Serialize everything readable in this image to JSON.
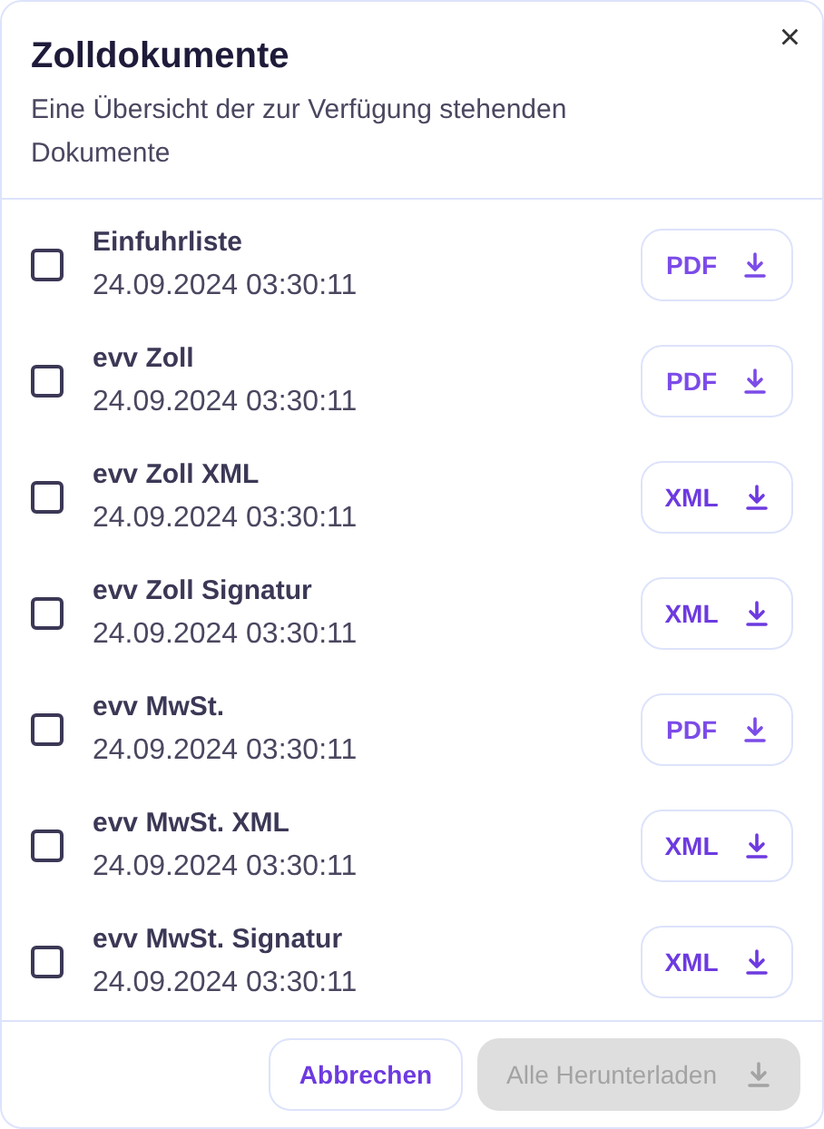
{
  "dialog": {
    "title": "Zolldokumente",
    "description": "Eine Übersicht der zur Verfügung stehenden Dokumente",
    "close": "×"
  },
  "documents": [
    {
      "name": "Einfuhrliste",
      "date": "24.09.2024 03:30:11",
      "format": "PDF",
      "checked": false
    },
    {
      "name": "evv Zoll",
      "date": "24.09.2024 03:30:11",
      "format": "PDF",
      "checked": false
    },
    {
      "name": "evv Zoll XML",
      "date": "24.09.2024 03:30:11",
      "format": "XML",
      "checked": false
    },
    {
      "name": "evv Zoll Signatur",
      "date": "24.09.2024 03:30:11",
      "format": "XML",
      "checked": false
    },
    {
      "name": "evv MwSt.",
      "date": "24.09.2024 03:30:11",
      "format": "PDF",
      "checked": false
    },
    {
      "name": "evv MwSt. XML",
      "date": "24.09.2024 03:30:11",
      "format": "XML",
      "checked": false
    },
    {
      "name": "evv MwSt. Signatur",
      "date": "24.09.2024 03:30:11",
      "format": "XML",
      "checked": false
    }
  ],
  "footer": {
    "cancel": "Abbrechen",
    "download_all": {
      "label": "Alle Herunterladen",
      "disabled": true
    }
  }
}
